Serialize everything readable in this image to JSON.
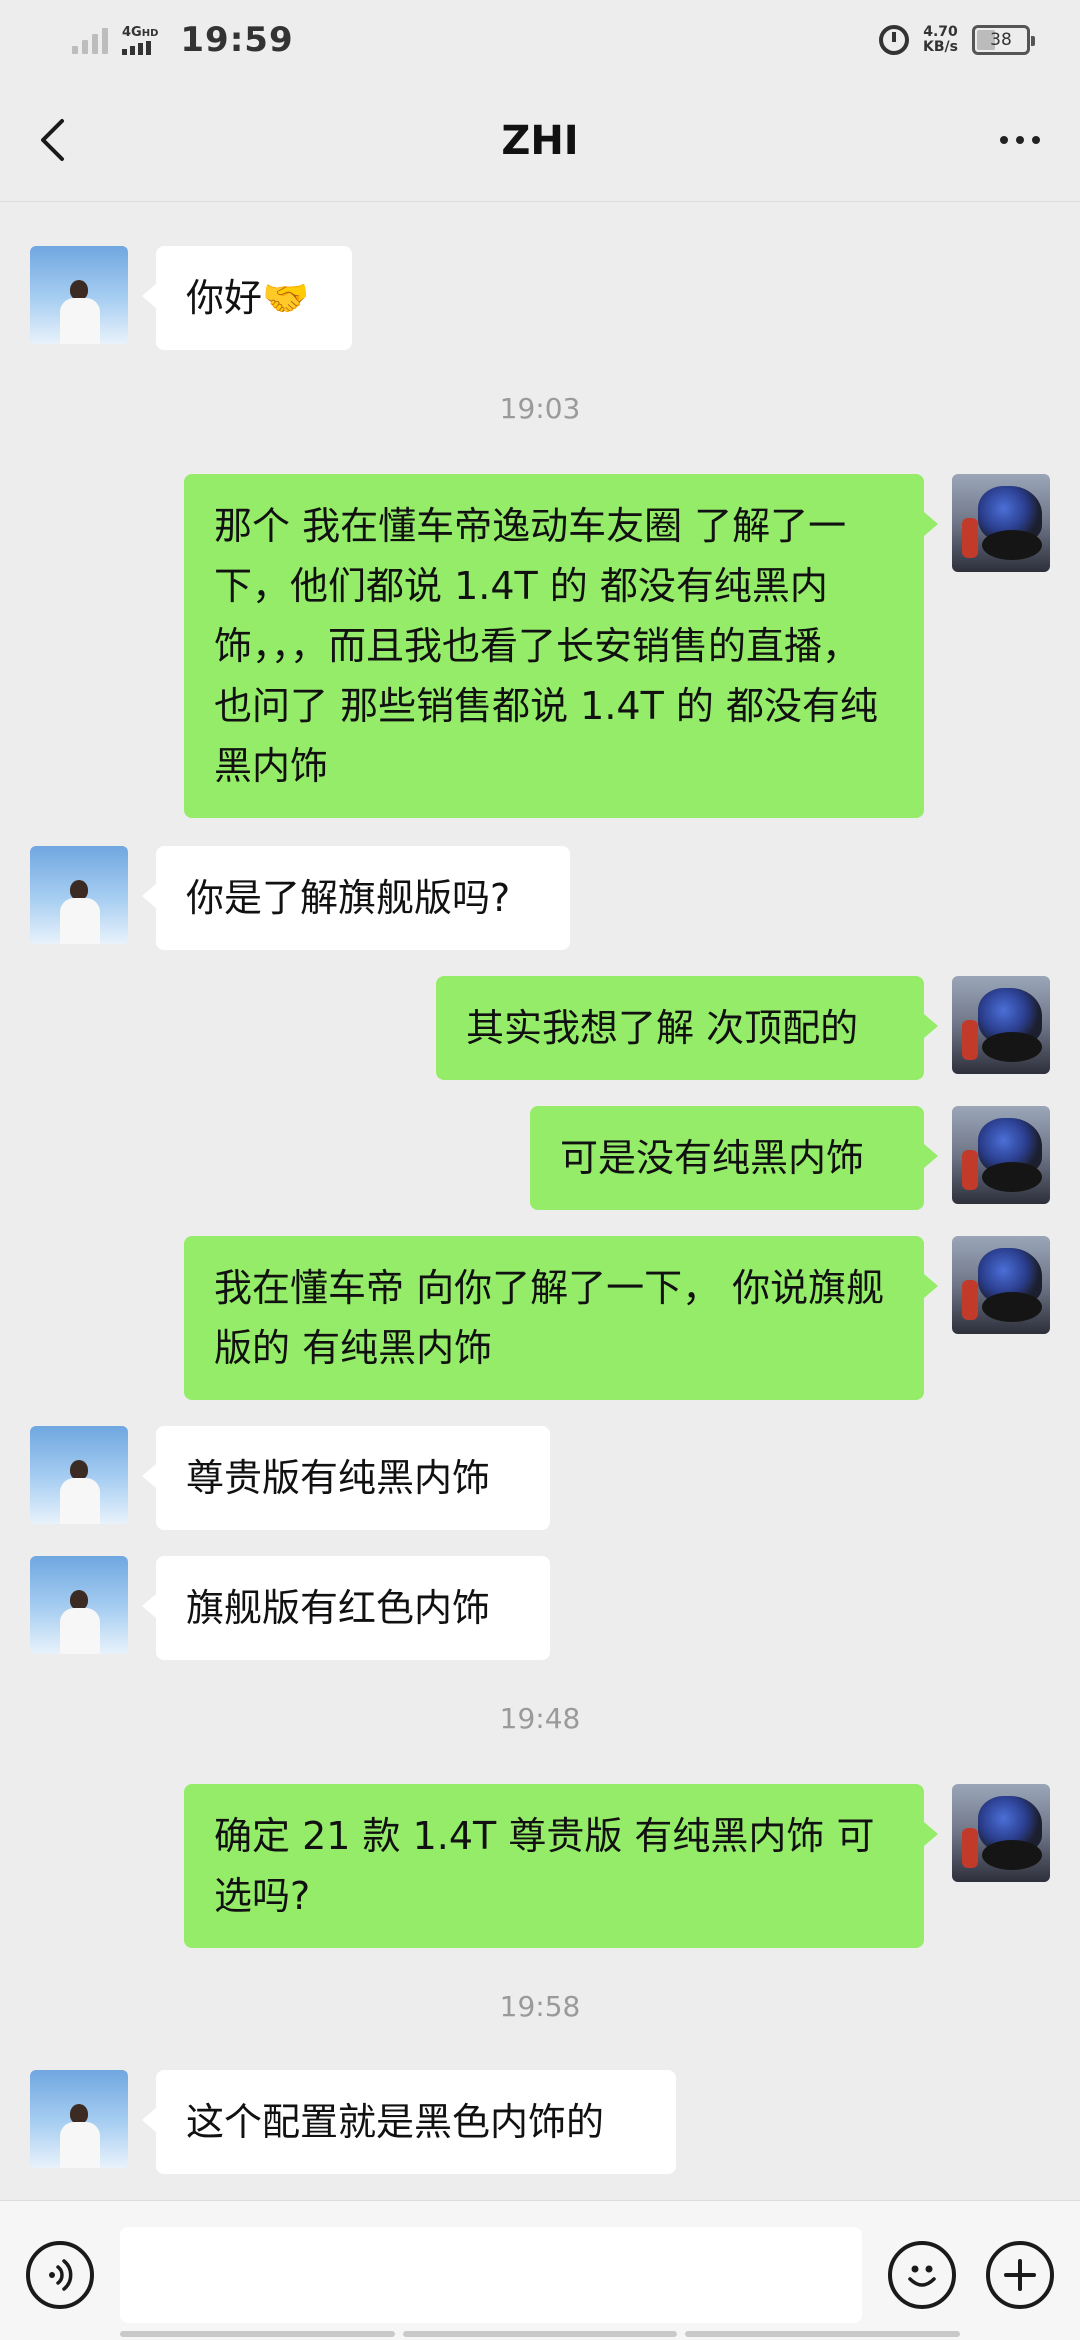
{
  "status_bar": {
    "network_label": "4G",
    "network_sub": "HD",
    "time": "19:59",
    "speed_value": "4.70",
    "speed_unit": "KB/s",
    "battery": "38"
  },
  "nav": {
    "title": "ZHI",
    "back_icon": "chevron-left-icon",
    "more_icon": "more-dots-icon"
  },
  "messages": [
    {
      "side": "left",
      "text": "你好🤝"
    },
    {
      "type": "time",
      "text": "19:03"
    },
    {
      "side": "right",
      "text": "那个 我在懂车帝逸动车友圈 了解了一下，他们都说 1.4T 的 都没有纯黑内饰，，，而且我也看了长安销售的直播，也问了 那些销售都说 1.4T 的 都没有纯黑内饰"
    },
    {
      "side": "left",
      "text": "你是了解旗舰版吗?"
    },
    {
      "side": "right",
      "text": "其实我想了解 次顶配的"
    },
    {
      "side": "right",
      "text": "可是没有纯黑内饰"
    },
    {
      "side": "right",
      "text": "我在懂车帝 向你了解了一下， 你说旗舰版的 有纯黑内饰"
    },
    {
      "side": "left",
      "text": "尊贵版有纯黑内饰"
    },
    {
      "side": "left",
      "text": "旗舰版有红色内饰"
    },
    {
      "type": "time",
      "text": "19:48"
    },
    {
      "side": "right",
      "text": "确定 21 款 1.4T 尊贵版 有纯黑内饰 可选吗?"
    },
    {
      "type": "time",
      "text": "19:58"
    },
    {
      "side": "left",
      "text": "这个配置就是黑色内饰的"
    }
  ],
  "input_bar": {
    "voice_icon": "voice-icon",
    "emoji_icon": "emoji-icon",
    "plus_icon": "plus-icon",
    "input_value": ""
  },
  "colors": {
    "background": "#ededed",
    "outgoing_bubble": "#95ec69",
    "incoming_bubble": "#ffffff",
    "timestamp": "#9a9a9a"
  }
}
